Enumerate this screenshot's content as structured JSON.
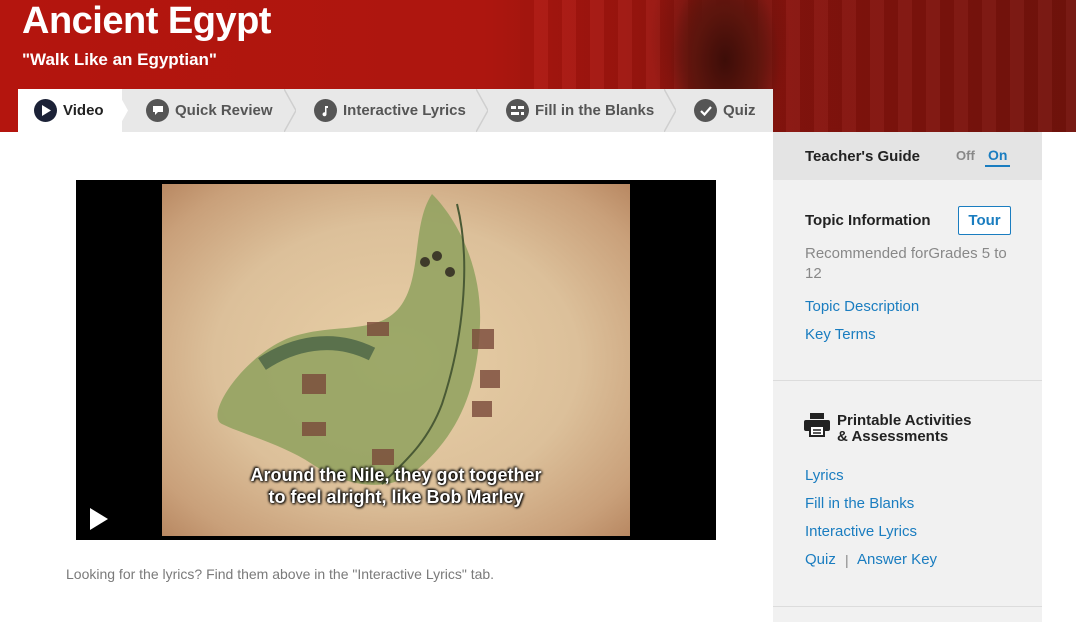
{
  "header": {
    "title": "Ancient Egypt",
    "subtitle": "\"Walk Like an Egyptian\""
  },
  "tabs": [
    {
      "label": "Video",
      "icon": "play-icon",
      "active": true
    },
    {
      "label": "Quick Review",
      "icon": "speech-bubble-icon",
      "active": false
    },
    {
      "label": "Interactive Lyrics",
      "icon": "music-note-icon",
      "active": false
    },
    {
      "label": "Fill in the Blanks",
      "icon": "blanks-icon",
      "active": false
    },
    {
      "label": "Quiz",
      "icon": "checkmark-icon",
      "active": false
    }
  ],
  "video": {
    "subtitle_line1": "Around the Nile, they got together",
    "subtitle_line2": "to feel alright, like Bob Marley"
  },
  "hint": "Looking for the lyrics? Find them above in the \"Interactive Lyrics\" tab.",
  "sidebar": {
    "teachers_guide": "Teacher's Guide",
    "off": "Off",
    "on": "On",
    "topic_information": "Topic Information",
    "tour": "Tour",
    "recommended": "Recommended forGrades 5 to 12",
    "topic_description": "Topic Description",
    "key_terms": "Key Terms",
    "printable_line1": "Printable Activities",
    "printable_line2": "& Assessments",
    "lyrics": "Lyrics",
    "fill_in_blanks": "Fill in the Blanks",
    "interactive_lyrics": "Interactive Lyrics",
    "quiz": "Quiz",
    "separator": "|",
    "answer_key": "Answer Key"
  },
  "colors": {
    "header_red": "#b4150e",
    "link_blue": "#1a7dc0",
    "tab_bg": "#e8e8e8",
    "sidebar_bg": "#f1f1f1"
  }
}
